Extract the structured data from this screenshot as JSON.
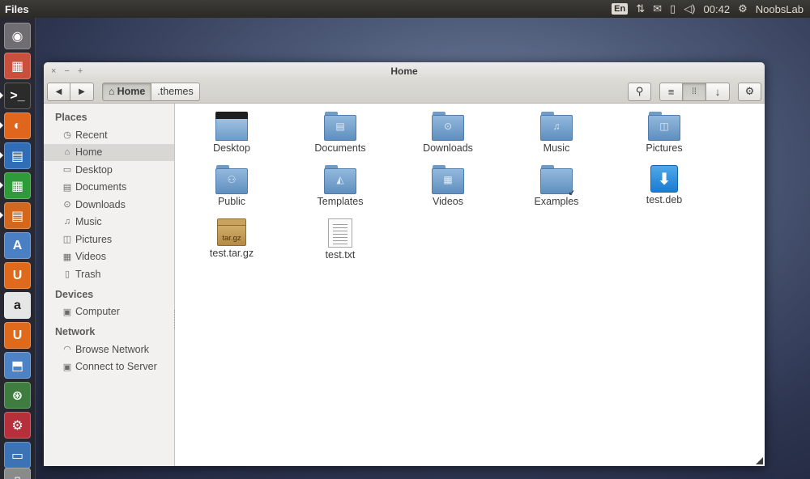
{
  "top_panel": {
    "app_title": "Files",
    "keyboard": "En",
    "icons": [
      "network-icon",
      "mail-icon",
      "battery-icon",
      "volume-icon"
    ],
    "clock": "00:42",
    "user": "NoobsLab",
    "gear": "gear-icon"
  },
  "launcher": {
    "items": [
      {
        "name": "dash-home",
        "glyph": "◉",
        "color": "#6f6c72"
      },
      {
        "name": "files",
        "glyph": "▦",
        "color": "#c8503c"
      },
      {
        "name": "terminal",
        "glyph": ">_",
        "color": "#2b2b2b"
      },
      {
        "name": "firefox",
        "glyph": "◐",
        "color": "#e0661d"
      },
      {
        "name": "libreoffice-writer",
        "glyph": "▤",
        "color": "#2f6db6"
      },
      {
        "name": "libreoffice-calc",
        "glyph": "▦",
        "color": "#2f9a3a"
      },
      {
        "name": "libreoffice-impress",
        "glyph": "▤",
        "color": "#d2681e"
      },
      {
        "name": "software-center",
        "glyph": "A",
        "color": "#4a7fc4"
      },
      {
        "name": "ubuntu-one",
        "glyph": "U",
        "color": "#e06a1c"
      },
      {
        "name": "amazon",
        "glyph": "a",
        "color": "#e6e6e6"
      },
      {
        "name": "ubuntu-one-music",
        "glyph": "U",
        "color": "#e06a1c"
      },
      {
        "name": "settings-drive",
        "glyph": "⬒",
        "color": "#4d83c5"
      },
      {
        "name": "update-manager",
        "glyph": "⊛",
        "color": "#3e7d3f"
      },
      {
        "name": "system-settings",
        "glyph": "⚙",
        "color": "#b5303a"
      },
      {
        "name": "workspace-switcher",
        "glyph": "▭",
        "color": "#3c73b5"
      },
      {
        "name": "trash",
        "glyph": "▯",
        "color": "#8a8a8a"
      }
    ]
  },
  "window": {
    "title": "Home",
    "buttons": {
      "close": "×",
      "minimize": "−",
      "maximize": "+"
    },
    "toolbar": {
      "back": "◀",
      "forward": "▶",
      "breadcrumbs": [
        {
          "label": "Home",
          "icon": "⌂"
        },
        {
          "label": ".themes"
        }
      ],
      "search": "⚲",
      "list_view": "≡",
      "grid_view": "⁞⁞",
      "sort": "↓",
      "gear": "⚙"
    },
    "sidebar": {
      "sections": [
        {
          "title": "Places",
          "items": [
            {
              "label": "Recent",
              "icon": "◷"
            },
            {
              "label": "Home",
              "icon": "⌂",
              "selected": true
            },
            {
              "label": "Desktop",
              "icon": "▭"
            },
            {
              "label": "Documents",
              "icon": "▤"
            },
            {
              "label": "Downloads",
              "icon": "⊙"
            },
            {
              "label": "Music",
              "icon": "♫"
            },
            {
              "label": "Pictures",
              "icon": "◫"
            },
            {
              "label": "Videos",
              "icon": "▦"
            },
            {
              "label": "Trash",
              "icon": "▯"
            }
          ]
        },
        {
          "title": "Devices",
          "items": [
            {
              "label": "Computer",
              "icon": "▣"
            }
          ]
        },
        {
          "title": "Network",
          "items": [
            {
              "label": "Browse Network",
              "icon": "◠"
            },
            {
              "label": "Connect to Server",
              "icon": "▣"
            }
          ]
        }
      ]
    },
    "files": [
      {
        "label": "Desktop",
        "kind": "desktop"
      },
      {
        "label": "Documents",
        "kind": "folder",
        "emblem": "▤"
      },
      {
        "label": "Downloads",
        "kind": "folder",
        "emblem": "⊙"
      },
      {
        "label": "Music",
        "kind": "folder",
        "emblem": "♫"
      },
      {
        "label": "Pictures",
        "kind": "folder",
        "emblem": "◫"
      },
      {
        "label": "Public",
        "kind": "folder",
        "emblem": "⚇"
      },
      {
        "label": "Templates",
        "kind": "folder",
        "emblem": "◭"
      },
      {
        "label": "Videos",
        "kind": "folder",
        "emblem": "▦"
      },
      {
        "label": "Examples",
        "kind": "folder",
        "emblem": ""
      },
      {
        "label": "test.deb",
        "kind": "deb",
        "emblem": "⬇"
      },
      {
        "label": "test.tar.gz",
        "kind": "archive",
        "emblem": "tar.gz"
      },
      {
        "label": "test.txt",
        "kind": "text",
        "emblem": ""
      }
    ]
  }
}
